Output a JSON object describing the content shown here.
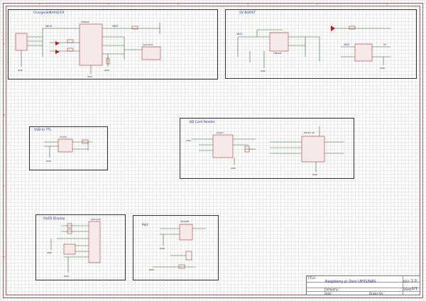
{
  "blocks": {
    "charger": {
      "title": "Charger&MAX4219"
    },
    "boost": {
      "title": "5V BOOST"
    },
    "usb": {
      "title": "USB to TTL"
    },
    "sdcard": {
      "title": "SD Card Reader"
    },
    "oled": {
      "title": "OLED Display"
    },
    "port": {
      "title": "Port"
    }
  },
  "parts": {
    "charger": {
      "ic": "TP4056",
      "ic2": "MAX4219",
      "vbat": "VBAT",
      "vbus": "VBUS",
      "gnd": "GND"
    },
    "boost": {
      "ic": "FP6298",
      "vbat": "VBAT",
      "v5": "5V",
      "gnd": "GND"
    },
    "usb": {
      "ic": "CH340",
      "gnd": "GND"
    },
    "sdcard": {
      "ic": "GL823",
      "ic2": "MICRO SD",
      "gnd": "GND"
    },
    "oled": {
      "ic": "SSD1306",
      "gnd": "GND"
    },
    "port": {
      "ic": "HEADER",
      "gnd": "GND"
    }
  },
  "title_block": {
    "title_label": "TITLE:",
    "title_value": "Raspberry pi Zero UPSS/NAS",
    "rev_label": "REV:",
    "rev_value": "1.0",
    "company_label": "Company:",
    "sheet_label": "Sheet:",
    "sheet_value": "1/1",
    "date_label": "Date:",
    "drawn_label": "Drawn By:"
  },
  "rulers": {
    "top": [
      "1",
      "2",
      "3",
      "4",
      "5",
      "6"
    ],
    "side": [
      "A",
      "B",
      "C",
      "D"
    ]
  }
}
